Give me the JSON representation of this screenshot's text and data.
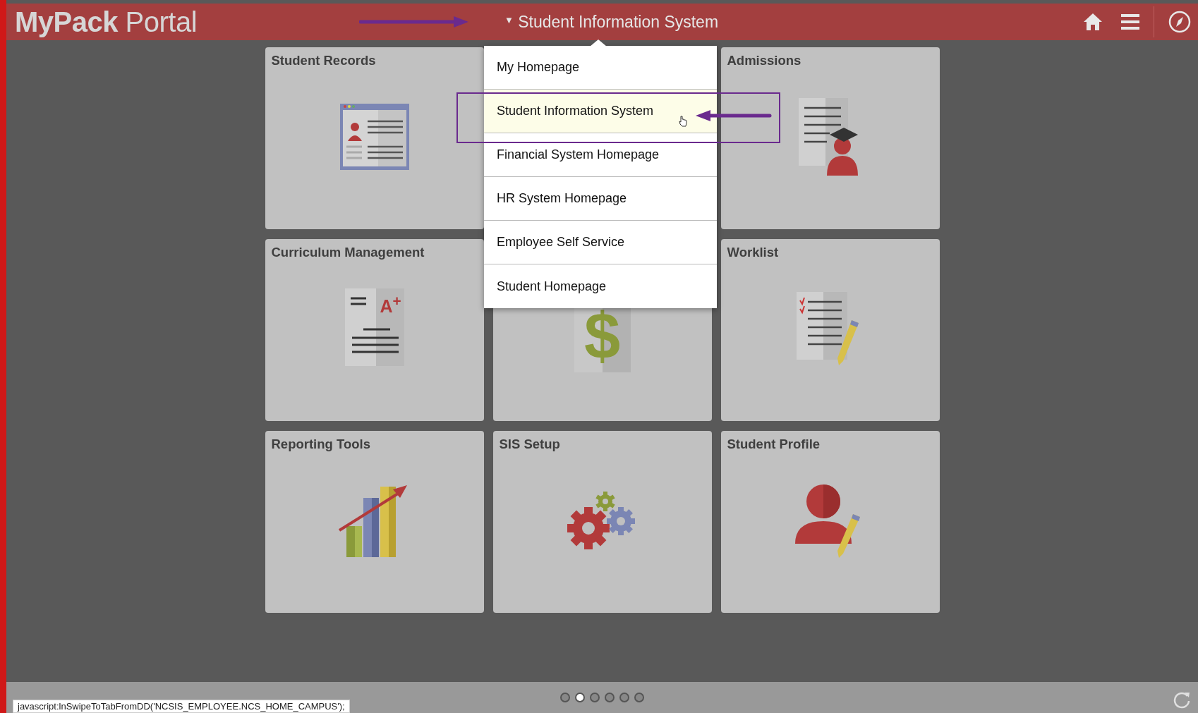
{
  "header": {
    "logo_bold": "MyPack",
    "logo_light": "Portal",
    "title_caret": "▼",
    "title": "Student Information System"
  },
  "tiles": [
    {
      "title": "Student Records"
    },
    {
      "title": "Admissions"
    },
    {
      "title": "Curriculum Management",
      "icon_text": "A$^{+}$"
    },
    {
      "icon_text": "$"
    },
    {
      "title": "Worklist"
    },
    {
      "title": "Reporting Tools"
    },
    {
      "title": "SIS Setup"
    },
    {
      "title": "Student Profile"
    }
  ],
  "menu": {
    "items": [
      {
        "label": "My Homepage",
        "selected": false
      },
      {
        "label": "Student Information System",
        "selected": true
      },
      {
        "label": "Financial System Homepage",
        "selected": false
      },
      {
        "label": "HR System Homepage",
        "selected": false
      },
      {
        "label": "Employee Self Service",
        "selected": false
      },
      {
        "label": "Student Homepage",
        "selected": false
      }
    ]
  },
  "pager": {
    "dots": [
      {
        "selected": false
      },
      {
        "selected": true
      },
      {
        "selected": false
      },
      {
        "selected": false
      },
      {
        "selected": false
      },
      {
        "selected": false
      }
    ]
  },
  "status_bar": {
    "url": "javascript:lnSwipeToTabFromDD('NCSIS_EMPLOYEE.NCS_HOME_CAMPUS');"
  }
}
